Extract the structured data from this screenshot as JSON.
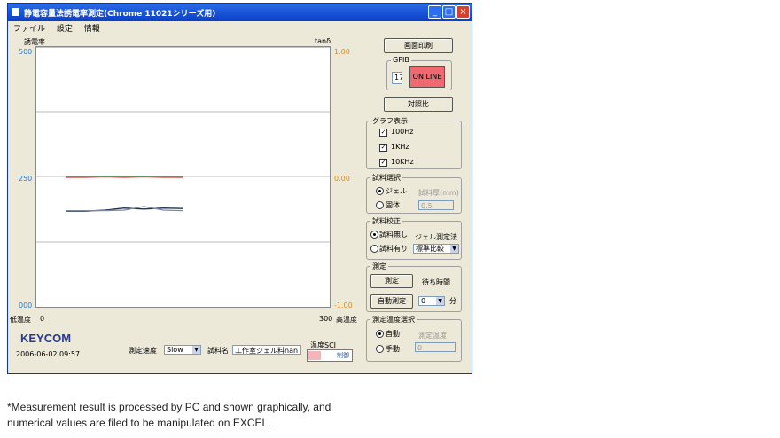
{
  "window": {
    "title": "静電容量法誘電率測定(Chrome 11021シリーズ用)"
  },
  "menu": [
    "ファイル",
    "設定",
    "情報"
  ],
  "chart": {
    "left_label": "誘電率",
    "right_label": "tanδ",
    "left_ticks": [
      "500",
      "250",
      "000"
    ],
    "right_ticks": [
      "1.00",
      "0.00",
      "-1.00"
    ],
    "x_left_caption": "低温度",
    "x_min": "0",
    "x_max": "300",
    "x_right_caption": "高温度",
    "colors": {
      "plot_red": "#e85050",
      "plot_green": "#4aa064",
      "plot_dark": "#223355",
      "plot_gray": "#7a8aa0"
    }
  },
  "chart_data": {
    "type": "line",
    "xlabel": "",
    "ylabel": "誘電率",
    "ylabel_right": "tanδ",
    "xlim": [
      0,
      300
    ],
    "ylim": [
      0,
      500
    ],
    "series": [
      {
        "x": [
          30,
          50,
          70,
          90,
          110,
          130,
          150
        ],
        "values": [
          249,
          249,
          250,
          249,
          250,
          249,
          249
        ]
      },
      {
        "x": [
          30,
          50,
          70,
          90,
          110,
          130,
          150
        ],
        "values": [
          250,
          250,
          251,
          251,
          251,
          250,
          250
        ]
      },
      {
        "x": [
          30,
          50,
          70,
          90,
          110,
          130,
          150
        ],
        "values": [
          184,
          184,
          186,
          190,
          188,
          190,
          189
        ]
      },
      {
        "x": [
          30,
          50,
          70,
          90,
          110,
          130,
          150
        ],
        "values": [
          185,
          185,
          185,
          186,
          193,
          186,
          185
        ]
      }
    ]
  },
  "buttons": {
    "print": "画面印刷",
    "compare": "対照比",
    "measure": "測定",
    "auto_measure": "自動測定"
  },
  "gpib": {
    "label": "GPIB",
    "address": "17",
    "online": "ON LINE",
    "online_color": "#f06870"
  },
  "graph_display": {
    "label": "グラフ表示",
    "items": [
      "100Hz",
      "1KHz",
      "10KHz"
    ],
    "checked": [
      true,
      true,
      true
    ]
  },
  "sample_select": {
    "label": "試料選択",
    "options": [
      "ジェル",
      "固体"
    ],
    "selected": 0,
    "thickness_label": "試料厚(mm)",
    "thickness_value": "0.5"
  },
  "sample_calib": {
    "label": "試料校正",
    "options": [
      "試料無し",
      "試料有り"
    ],
    "selected": 0,
    "method_label": "ジェル測定法",
    "method_value": "標準比較"
  },
  "measurement": {
    "label": "測定",
    "wait_label": "待ち時間",
    "wait_value": "0",
    "wait_unit": "分"
  },
  "temp_select": {
    "label": "測定温度選択",
    "options": [
      "自動",
      "手動"
    ],
    "selected": 0,
    "temp_label": "測定温度",
    "temp_value": "0"
  },
  "bottom": {
    "brand": "KEYCOM",
    "date": "2006-06-02",
    "time": "09:57",
    "speed_label": "測定速度",
    "speed_value": "Slow",
    "sample_name_label": "試料名",
    "sample_name_value": "工作室ジェル料nan",
    "temp_status_label": "温度SCI",
    "temp_status_value": "制御"
  },
  "caption": {
    "line1": "*Measurement result is processed by PC and shown graphically, and",
    "line2": "numerical values are filed to be manipulated on EXCEL."
  }
}
